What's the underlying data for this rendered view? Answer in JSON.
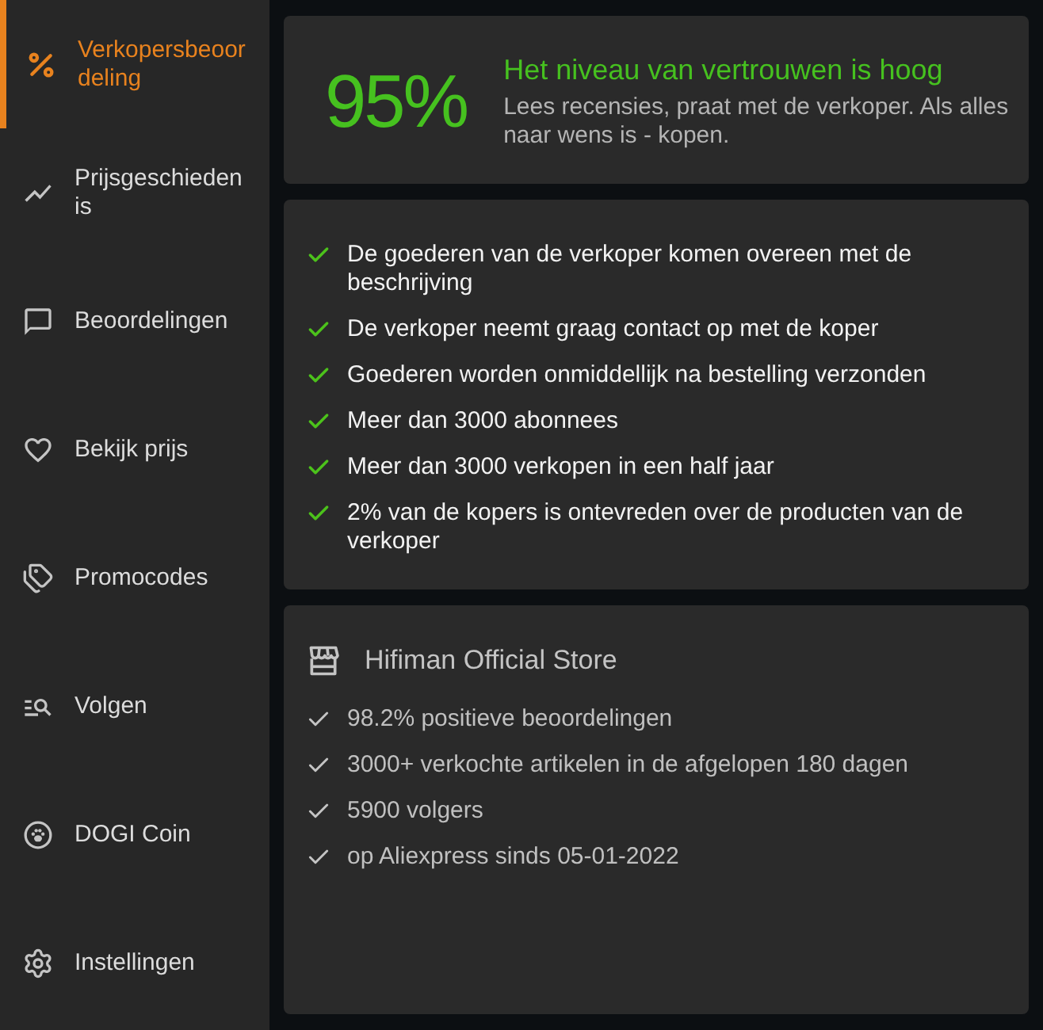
{
  "sidebar": {
    "items": [
      {
        "label": "Verkopersbeoordeling",
        "selected": true
      },
      {
        "label": "Prijsgeschiedenis",
        "selected": false
      },
      {
        "label": "Beoordelingen",
        "selected": false
      },
      {
        "label": "Bekijk prijs",
        "selected": false
      },
      {
        "label": "Promocodes",
        "selected": false
      },
      {
        "label": "Volgen",
        "selected": false
      },
      {
        "label": "DOGI Coin",
        "selected": false
      },
      {
        "label": "Instellingen",
        "selected": false
      }
    ]
  },
  "trust": {
    "score": "95%",
    "title": "Het niveau van vertrouwen is hoog",
    "description": "Lees recensies, praat met de verkoper. Als alles naar wens is - kopen."
  },
  "criteria": {
    "items": [
      "De goederen van de verkoper komen overeen met de beschrijving",
      "De verkoper neemt graag contact op met de koper",
      "Goederen worden onmiddellijk na bestelling verzonden",
      "Meer dan 3000 abonnees",
      "Meer dan 3000 verkopen in een half jaar",
      "2% van de kopers is ontevreden over de producten van de verkoper"
    ]
  },
  "store": {
    "name": "Hifiman Official Store",
    "facts": [
      "98.2% positieve beoordelingen",
      "3000+ verkochte artikelen in de afgelopen 180 dagen",
      "5900 volgers",
      "op Aliexpress sinds 05-01-2022"
    ]
  }
}
